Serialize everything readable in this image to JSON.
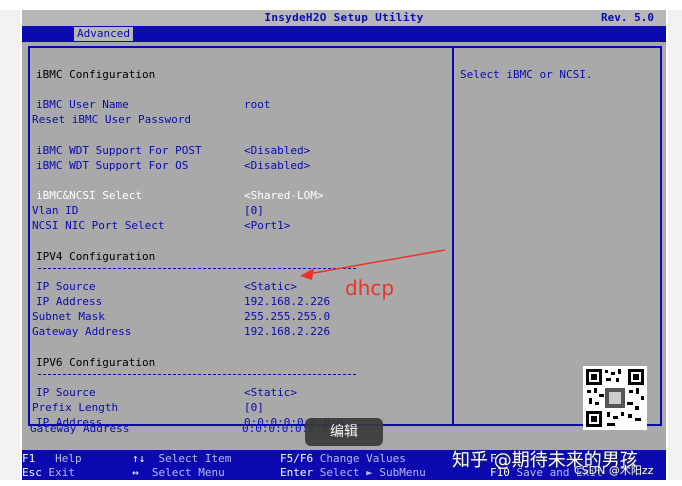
{
  "window": {
    "title": "InsydeH2O Setup Utility",
    "revision": "Rev. 5.0"
  },
  "tabs": [
    {
      "label": "Advanced"
    }
  ],
  "main": {
    "section_title": "iBMC Configuration",
    "rows": {
      "ibmc_user_name": {
        "label": "iBMC User Name",
        "value": "root"
      },
      "reset_password": {
        "label": "Reset iBMC User Password"
      },
      "wdt_post": {
        "label": "iBMC WDT Support For POST",
        "value": "<Disabled>"
      },
      "wdt_os": {
        "label": "iBMC WDT Support For OS",
        "value": "<Disabled>"
      },
      "ncsi_select": {
        "label": "iBMC&NCSI Select",
        "value": "<Shared-LOM>"
      },
      "vlan_id": {
        "label": "Vlan ID",
        "value": "[0]"
      },
      "ncsi_port": {
        "label": "NCSI NIC Port Select",
        "value": "<Port1>"
      }
    },
    "ipv4": {
      "title": "IPV4 Configuration",
      "ip_source": {
        "label": "IP Source",
        "value": "<Static>"
      },
      "ip_address": {
        "label": "IP Address",
        "value": "192.168.2.226"
      },
      "subnet_mask": {
        "label": "Subnet Mask",
        "value": "255.255.255.0"
      },
      "gateway": {
        "label": "Gateway Address",
        "value": "192.168.2.226"
      }
    },
    "ipv6": {
      "title": "IPV6 Configuration",
      "ip_source": {
        "label": "IP Source",
        "value": "<Static>"
      },
      "prefix_length": {
        "label": "Prefix Length",
        "value": "[0]"
      },
      "ip_address": {
        "label": "IP Address",
        "value": "0:0:0:0:0:0:0:0"
      },
      "gateway": {
        "label": "Gateway Address",
        "value": "0:0:0:0:0:0:0:0"
      }
    }
  },
  "help": {
    "text": "Select iBMC or NCSI."
  },
  "footer": {
    "f1_key": "F1",
    "f1_desc": "Help",
    "esc_key": "Esc",
    "esc_desc": "Exit",
    "updown_key": "↑↓",
    "updown_desc": "Select Item",
    "leftright_key": "↔",
    "leftright_desc": "Select Menu",
    "f5f6_key": "F5/F6",
    "f5f6_desc": "Change Values",
    "enter_key": "Enter",
    "enter_desc": "Select ► SubMenu",
    "f9_key": "F",
    "f10_key": "F10",
    "f10_desc": "Save and Exit"
  },
  "overlays": {
    "annotation": "dhcp",
    "annotation_color": "#e8342a",
    "edit_button": "编辑",
    "watermark": "知乎 @期待未来的男孩",
    "csdn": "CSDN @木阳zz"
  },
  "colors": {
    "bios_blue": "#0a0ab0",
    "bios_gray": "#a9a9a9"
  }
}
